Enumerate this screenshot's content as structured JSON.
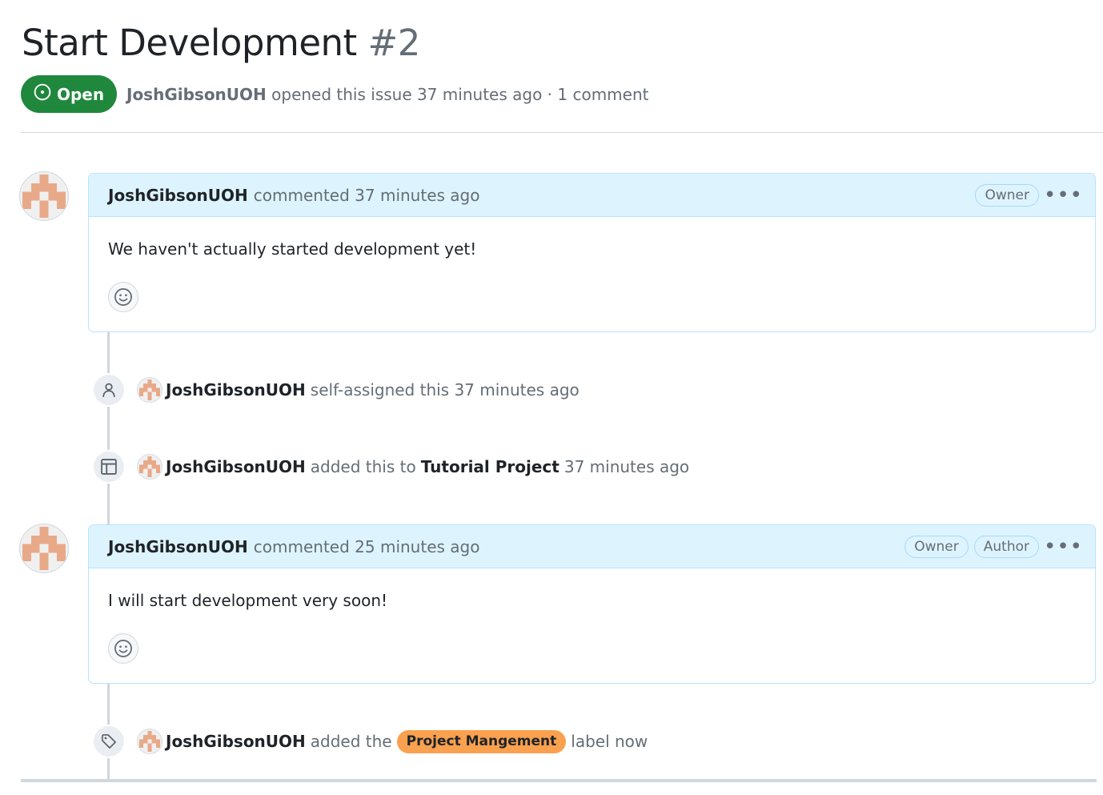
{
  "issue": {
    "title": "Start Development",
    "number": "#2",
    "state": "Open",
    "author": "JoshGibsonUOH",
    "opened_text": "opened this issue 37 minutes ago · 1 comment"
  },
  "comments": [
    {
      "author": "JoshGibsonUOH",
      "action": "commented 37 minutes ago",
      "badges": [
        "Owner"
      ],
      "body": "We haven't actually started development yet!"
    },
    {
      "author": "JoshGibsonUOH",
      "action": "commented 25 minutes ago",
      "badges": [
        "Owner",
        "Author"
      ],
      "body": "I will start development very soon!"
    }
  ],
  "events": [
    {
      "icon": "person-icon",
      "actor": "JoshGibsonUOH",
      "text": "self-assigned this 37 minutes ago"
    },
    {
      "icon": "project-table-icon",
      "actor": "JoshGibsonUOH",
      "text_before": "added this to",
      "target": "Tutorial Project",
      "text_after": "37 minutes ago"
    },
    {
      "icon": "tag-icon",
      "actor": "JoshGibsonUOH",
      "text_before": "added the",
      "label": "Project Mangement",
      "label_color": "#f9a14f",
      "text_after": "label now"
    }
  ],
  "icons": {
    "state": "issue-opened-icon",
    "reaction": "smiley-icon",
    "menu": "kebab-horizontal-icon",
    "avatar": "identicon-avatar"
  },
  "colors": {
    "open_green": "#1f883d",
    "comment_header_bg": "#ddf4ff",
    "comment_border": "#b6e3ff",
    "avatar_pattern": "#e8a989"
  }
}
